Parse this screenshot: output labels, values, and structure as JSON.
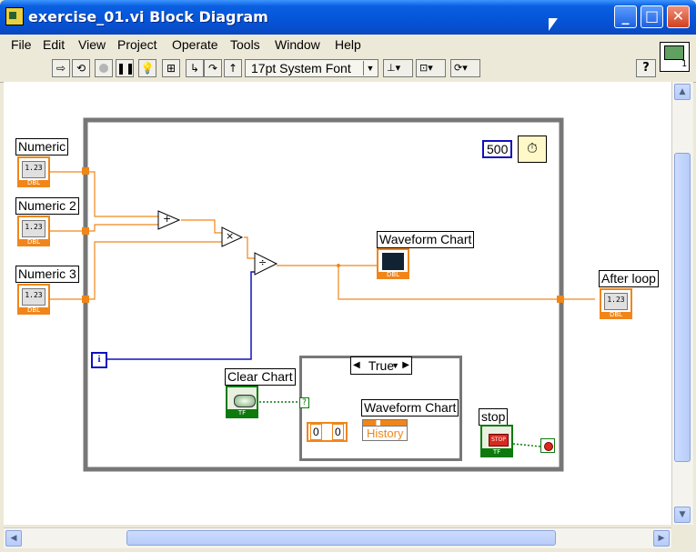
{
  "window": {
    "title": "exercise_01.vi Block Diagram",
    "controls": [
      "_",
      "□",
      "✕"
    ]
  },
  "menu": [
    "File",
    "Edit",
    "View",
    "Project",
    "Operate",
    "Tools",
    "Window",
    "Help"
  ],
  "toolbar": {
    "font": "17pt System Font",
    "help": "?"
  },
  "vi_icon_num": "1",
  "diagram": {
    "controls": [
      {
        "label": "Numeric",
        "value": "1.23",
        "type": "DBL"
      },
      {
        "label": "Numeric 2",
        "value": "1.23",
        "type": "DBL"
      },
      {
        "label": "Numeric 3",
        "value": "1.23",
        "type": "DBL"
      }
    ],
    "indicator": {
      "label": "After loop",
      "value": "1.23",
      "type": "DBL"
    },
    "chart_label": "Waveform Chart",
    "chart_type": "DBL",
    "timer_value": "500",
    "iteration": "i",
    "clear_chart": {
      "label": "Clear Chart",
      "type": "TF"
    },
    "stop": {
      "label": "stop",
      "button_text": "STOP",
      "type": "TF"
    },
    "case": {
      "selector": "True",
      "question": "?",
      "cluster": [
        "0",
        "0"
      ],
      "property_label": "Waveform Chart",
      "property": "History"
    },
    "ops": [
      "+",
      "×",
      "÷"
    ],
    "colors": {
      "float": "#f0861a",
      "int": "#1010c0",
      "bool": "#0c7a0c"
    }
  }
}
